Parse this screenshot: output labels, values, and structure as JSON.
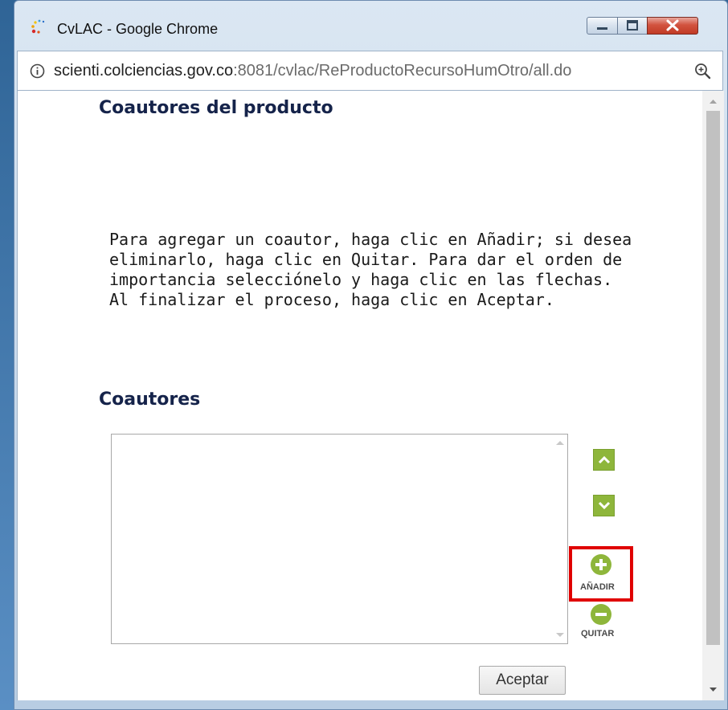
{
  "window": {
    "title": "CvLAC - Google Chrome",
    "controls": [
      "minimize",
      "maximize",
      "close"
    ]
  },
  "address_bar": {
    "host": "scienti.colciencias.gov.co",
    "path": ":8081/cvlac/ReProductoRecursoHumOtro/all.do"
  },
  "page": {
    "heading": "Coautores del producto",
    "instructions": [
      "Para agregar un coautor, haga clic en Añadir; si desea",
      "eliminarlo, haga clic en Quitar. Para dar el orden de",
      "importancia selecciónelo y haga clic en las flechas.",
      "Al finalizar el proceso, haga clic en Aceptar."
    ],
    "coauthors_heading": "Coautores",
    "coauthors_list": [],
    "add_label": "AÑADIR",
    "remove_label": "QUITAR",
    "accept_label": "Aceptar"
  },
  "colors": {
    "heading": "#15234a",
    "green_button": "#8eb63b",
    "highlight": "#e00000"
  },
  "icons": [
    "app-icon",
    "info-icon",
    "zoom-icon",
    "move-up-icon",
    "move-down-icon",
    "add-icon",
    "remove-icon"
  ]
}
